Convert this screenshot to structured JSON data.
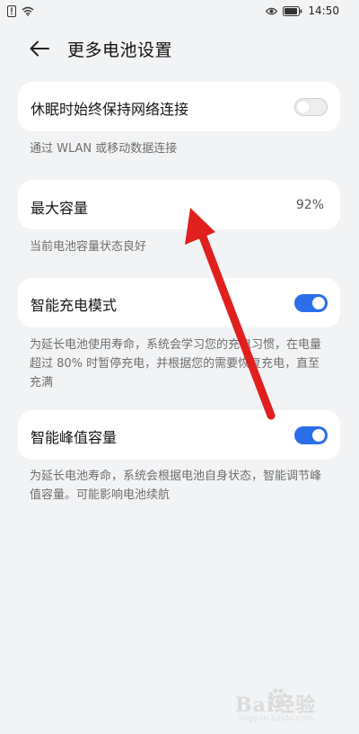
{
  "status_bar": {
    "time": "14:50"
  },
  "header": {
    "title": "更多电池设置"
  },
  "settings": {
    "network_keep": {
      "label": "休眠时始终保持网络连接",
      "enabled": false,
      "description": "通过 WLAN 或移动数据连接"
    },
    "max_capacity": {
      "label": "最大容量",
      "value": "92%",
      "description": "当前电池容量状态良好"
    },
    "smart_charging": {
      "label": "智能充电模式",
      "enabled": true,
      "description": "为延长电池使用寿命，系统会学习您的充电习惯，在电量超过 80% 时暂停充电，并根据您的需要恢复充电，直至充满"
    },
    "smart_peak": {
      "label": "智能峰值容量",
      "enabled": true,
      "description": "为延长电池寿命，系统会根据电池自身状态，智能调节峰值容量。可能影响电池续航"
    }
  },
  "watermark": {
    "text": "Bai经验",
    "sub": "jingyan.baidu.com"
  },
  "colors": {
    "background": "#f1f3f5",
    "card": "#ffffff",
    "accent": "#2b6ee8",
    "annotation_arrow": "#e0201f"
  }
}
